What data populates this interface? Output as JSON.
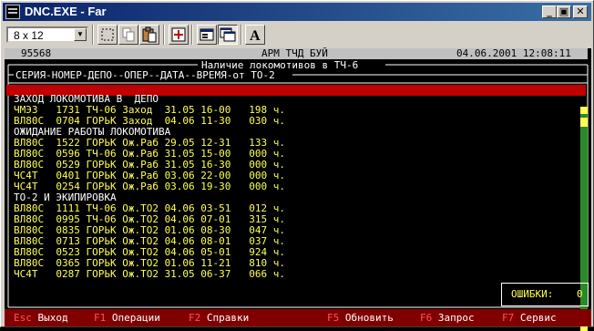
{
  "window": {
    "title": "DNC.EXE - Far"
  },
  "toolbar": {
    "font_size": "8 x 12"
  },
  "header": {
    "code": "95568",
    "center": "АРМ ТЧД БУЙ",
    "datetime": "04.06.2001 12:08:11"
  },
  "panel": {
    "title": "Наличие локомотивов в ТЧ-6",
    "columns": "СЕРИЯ-НОМЕР-ДЕПО--ОПЕР--ДАТА--ВРЕМЯ-от ТО-2"
  },
  "sections": [
    {
      "title": "ЗАХОД ЛОКОМОТИВА В  ДЕПО",
      "rows": [
        "ЧМЭ3   1731 ТЧ-06 Заход  31.05 16-00   198 ч.",
        "ВЛ80С  0704 ГОРЬК Заход  04.06 11-30   030 ч."
      ]
    },
    {
      "title": "ОЖИДАНИЕ РАБОТЫ ЛОКОМОТИВА",
      "rows": [
        "ВЛ80С  1522 ГОРЬК Ож.Раб 29.05 12-31   133 ч.",
        "ВЛ80С  0596 ТЧ-06 Ож.Раб 31.05 15-00   000 ч.",
        "ВЛ80С  0529 ГОРЬК Ож.Раб 31.05 16-30   000 ч.",
        "ЧС4Т   0401 ГОРЬК Ож.Раб 03.06 22-00   000 ч.",
        "ЧС4Т   0254 ГОРЬК Ож.Раб 03.06 19-30   000 ч."
      ]
    },
    {
      "title": "ТО-2 И ЭКИПИРОВКА",
      "rows": [
        "ВЛ80С  1111 ТЧ-06 Ож.ТО2 04.06 03-51   012 ч.",
        "ВЛ80С  0995 ТЧ-06 Ож.ТО2 04.06 07-01   315 ч.",
        "ВЛ80С  0835 ГОРЬК Ож.ТО2 01.06 08-30   047 ч.",
        "ВЛ80С  0713 ГОРЬК Ож.ТО2 04.06 08-01   037 ч.",
        "ВЛ80С  0523 ГОРЬК Ож.ТО2 04.06 05-01   924 ч.",
        "ВЛ80С  0365 ГОРЬК Ож.ТО2 01.06 11-21   810 ч.",
        "ЧС4Т   0287 ГОРЬК Ож.ТО2 31.05 06-37   066 ч."
      ]
    }
  ],
  "errors": {
    "label": "ОШИБКИ:",
    "value": "0"
  },
  "statusbar": {
    "items": [
      {
        "key": "Esc",
        "label": "Выход"
      },
      {
        "key": "F1",
        "label": "Операции"
      },
      {
        "key": "F2",
        "label": "Справки"
      },
      {
        "key": "F5",
        "label": "Обновить"
      },
      {
        "key": "F6",
        "label": "Запрос"
      },
      {
        "key": "F7",
        "label": "Сервис"
      }
    ]
  },
  "colors": {
    "background": "#000000",
    "text": "#ffffff",
    "data": "#ffff55",
    "alert_bar": "#c00000",
    "statusbar": "#800000",
    "fkey": "#ff5555"
  },
  "icons": [
    "console-app-icon",
    "minimize-icon",
    "restore-icon",
    "close-icon",
    "select-icon",
    "copy-icon",
    "paste-icon",
    "fullscreen-icon",
    "properties-icon",
    "background-icon",
    "font-icon"
  ]
}
